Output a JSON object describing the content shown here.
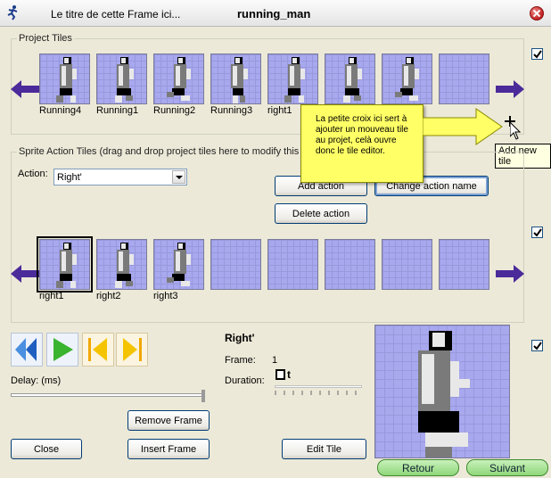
{
  "window": {
    "title": "Le titre de cette Frame ici...",
    "subtitle": "running_man"
  },
  "project_tiles": {
    "title": "Project Tiles",
    "tiles": [
      {
        "label": "Running4"
      },
      {
        "label": "Running1"
      },
      {
        "label": "Running2"
      },
      {
        "label": "Running3"
      },
      {
        "label": "right1"
      },
      {
        "label": ""
      },
      {
        "label": ""
      },
      {
        "label": ""
      }
    ],
    "add_tile_tooltip": "Add new tile"
  },
  "callout": {
    "text": "La petite croix ici sert à ajouter un mouveau tile au projet, celà ouvre donc le tile editor."
  },
  "sprite_actions": {
    "title": "Sprite Action Tiles (drag and drop project tiles here to modify this ac",
    "action_label": "Action:",
    "action_value": "Right'",
    "add_action": "Add action",
    "change_action_name": "Change action name",
    "delete_action": "Delete action",
    "tiles": [
      {
        "label": "right1"
      },
      {
        "label": "right2"
      },
      {
        "label": "right3"
      }
    ]
  },
  "playback": {
    "delay_label": "Delay: (ms)",
    "remove_frame": "Remove Frame",
    "insert_frame": "Insert Frame",
    "close": "Close",
    "edit_tile": "Edit Tile"
  },
  "frame_info": {
    "action_name": "Right'",
    "frame_label": "Frame:",
    "frame_value": "1",
    "duration_label": "Duration:",
    "duration_value": "t"
  },
  "nav": {
    "back": "Retour",
    "next": "Suivant"
  },
  "colors": {
    "tile_bg": "#a8a8ee",
    "arrow": "#4b2a9a",
    "callout": "#ffff66",
    "green_button": "#8fd77a"
  }
}
